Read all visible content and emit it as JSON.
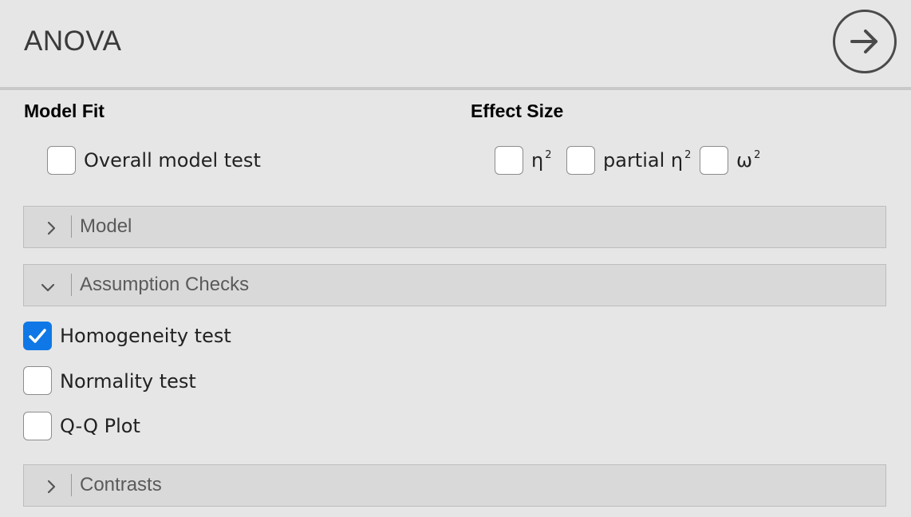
{
  "header": {
    "title": "ANOVA",
    "go_icon": "arrow-right-circle-icon"
  },
  "model_fit": {
    "heading": "Model Fit",
    "overall_model_test": {
      "label": "Overall model test",
      "checked": false
    }
  },
  "effect_size": {
    "heading": "Effect Size",
    "eta_sq": {
      "symbol": "η",
      "sup": "2",
      "checked": false
    },
    "partial_eta_sq": {
      "prefix": "partial η",
      "sup": "2",
      "checked": false
    },
    "omega_sq": {
      "symbol": "ω",
      "sup": "2",
      "checked": false
    }
  },
  "panels": {
    "model": {
      "title": "Model",
      "expanded": false
    },
    "assumption_checks": {
      "title": "Assumption Checks",
      "expanded": true
    },
    "contrasts": {
      "title": "Contrasts",
      "expanded": false
    }
  },
  "assumptions": {
    "homogeneity": {
      "label": "Homogeneity test",
      "checked": true
    },
    "normality": {
      "label": "Normality test",
      "checked": false
    },
    "qq_plot": {
      "label": "Q-Q Plot",
      "checked": false
    }
  },
  "colors": {
    "background": "#e6e6e6",
    "panel": "#d9d9d9",
    "accent": "#0f78e6"
  }
}
